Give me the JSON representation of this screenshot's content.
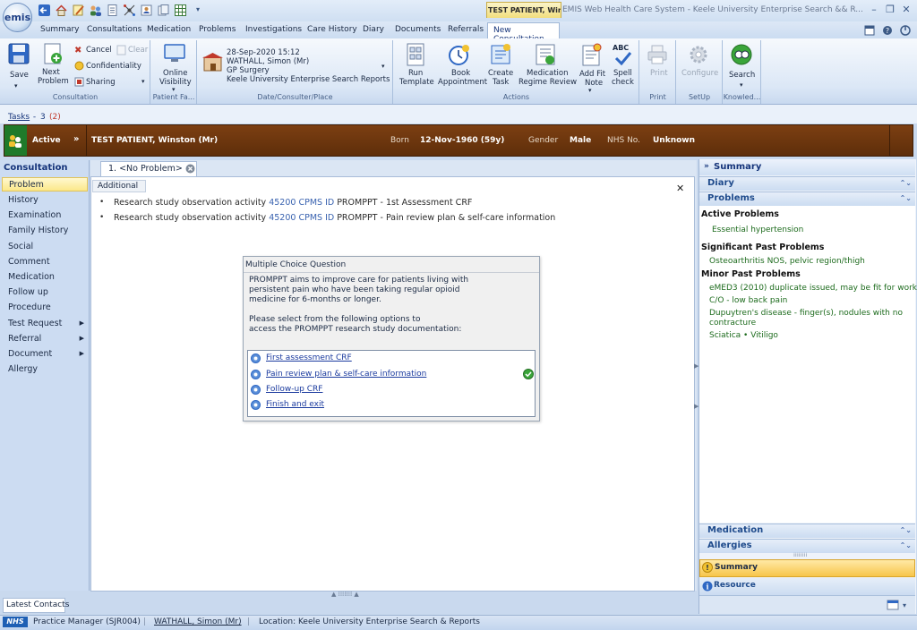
{
  "app": {
    "logo_text": "emis",
    "title": "EMIS Web Health Care System - Keele University Enterprise Search && R...",
    "patient_tab": "TEST PATIENT, Winst...",
    "window_controls": [
      "–",
      "❐",
      "✕"
    ]
  },
  "ribbon_tabs": [
    "Summary",
    "Consultations",
    "Medication",
    "Problems",
    "Investigations",
    "Care History",
    "Diary",
    "Documents",
    "Referrals",
    "New Consultation"
  ],
  "ribbon": {
    "consultation": {
      "save": "Save",
      "next_problem_1": "Next",
      "next_problem_2": "Problem",
      "cancel": "Cancel",
      "clear": "Clear",
      "confidentiality": "Confidentiality",
      "sharing": "Sharing",
      "group_label": "Consultation"
    },
    "patient_facing": {
      "online_1": "Online",
      "online_2": "Visibility",
      "group_label": "Patient Fa..."
    },
    "date_place": {
      "datetime": "28-Sep-2020 15:12",
      "consulter": "WATHALL, Simon (Mr)",
      "type": "GP Surgery",
      "place": "Keele University Enterprise Search  Reports",
      "group_label": "Date/Consulter/Place"
    },
    "actions": {
      "run_template_1": "Run",
      "run_template_2": "Template",
      "book_1": "Book",
      "book_2": "Appointment",
      "task_1": "Create",
      "task_2": "Task",
      "medrev_1": "Medication",
      "medrev_2": "Regime Review",
      "fitnote_1": "Add Fit",
      "fitnote_2": "Note",
      "spell_1": "Spell",
      "spell_2": "check",
      "spell_icon_text": "ABC",
      "group_label": "Actions"
    },
    "print": {
      "label": "Print",
      "group_label": "Print"
    },
    "setup": {
      "label": "Configure",
      "group_label": "SetUp"
    },
    "knowledge": {
      "label": "Search",
      "group_label": "Knowled..."
    }
  },
  "tasks": {
    "link": "Tasks",
    "sep": " - ",
    "count": "3",
    "unread": "(2)"
  },
  "patient": {
    "status": "Active",
    "name": "TEST PATIENT,  Winston  (Mr)",
    "born_label": "Born",
    "born": "12-Nov-1960 (59y)",
    "gender_label": "Gender",
    "gender": "Male",
    "nhs_label": "NHS No.",
    "nhs": "Unknown"
  },
  "left_nav": {
    "title": "Consultation",
    "items": [
      "Problem",
      "History",
      "Examination",
      "Family History",
      "Social",
      "Comment",
      "Medication",
      "Follow up",
      "Procedure",
      "Test Request",
      "Referral",
      "Document",
      "Allergy"
    ]
  },
  "editor": {
    "problem_tab": "1. <No Problem>",
    "section_tab": "Additional",
    "close": "✕",
    "observations": [
      {
        "prefix": "Research study observation activity ",
        "code": "45200 CPMS ID",
        "suffix": " PROMPPT - 1st Assessment CRF"
      },
      {
        "prefix": "Research study observation activity ",
        "code": "45200 CPMS ID",
        "suffix": " PROMPPT - Pain review plan & self-care information"
      }
    ]
  },
  "dialog": {
    "title": "Multiple Choice Question",
    "body": "PROMPPT aims to improve care for patients living with\npersistent pain who have been taking regular opioid\nmedicine for 6-months or longer.\n\nPlease select from the following options to\naccess the PROMPPT research study documentation:",
    "options": [
      "First assessment CRF",
      "Pain review plan & self-care information",
      "Follow-up CRF",
      "Finish and exit"
    ],
    "checked_option": "Pain review plan & self-care information"
  },
  "right_pane": {
    "title": "Summary",
    "sections": {
      "diary": "Diary",
      "problems": "Problems",
      "medication": "Medication",
      "allergies": "Allergies"
    },
    "active_head": "Active Problems",
    "active": [
      "Essential hypertension"
    ],
    "significant_head": "Significant Past Problems",
    "significant": [
      "Osteoarthritis NOS, pelvic region/thigh"
    ],
    "minor_head": "Minor Past Problems",
    "minor": [
      "eMED3 (2010) duplicate issued, may be fit for work",
      "C/O - low back pain",
      "Dupuytren's disease - finger(s), nodules with no",
      "contracture",
      "Sciatica  •  Vitiligo"
    ],
    "bottom_summary": "Summary",
    "bottom_resource": "Resource"
  },
  "latest_contacts": "Latest Contacts",
  "status": {
    "nhs": "NHS",
    "role": "Practice Manager (SJR004)",
    "user": "WATHALL, Simon (Mr)",
    "location": "Location:  Keele University Enterprise Search & Reports"
  },
  "colors": {
    "brand": "#15347a",
    "patient_banner": "#6b3510",
    "problem_green": "#1d6b1d",
    "highlight": "#fbe88a"
  }
}
